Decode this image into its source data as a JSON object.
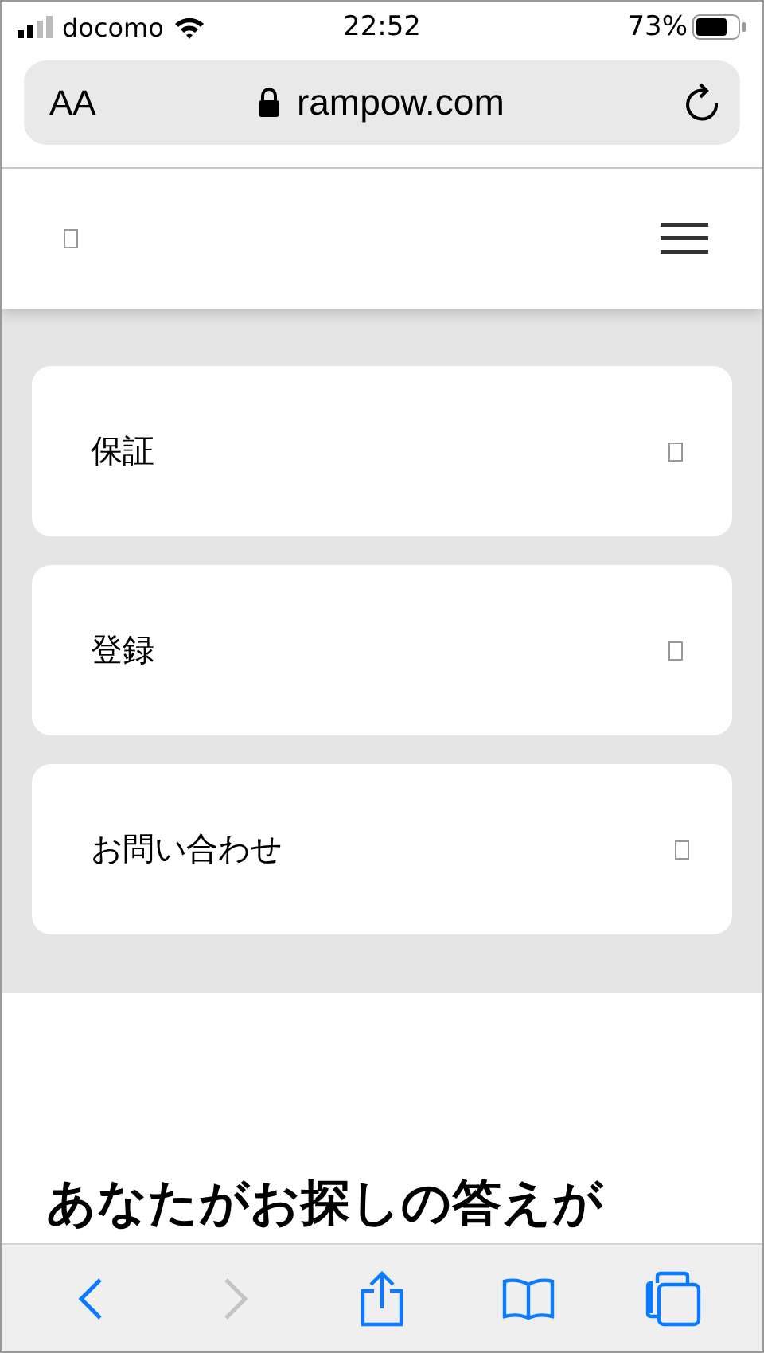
{
  "status_bar": {
    "carrier": "docomo",
    "time": "22:52",
    "battery": "73%"
  },
  "address_bar": {
    "text_size_label": "AA",
    "url": "rampow.com"
  },
  "menu_items": [
    {
      "label": "保証"
    },
    {
      "label": "登録"
    },
    {
      "label": "お問い合わせ"
    }
  ],
  "heading": "あなたがお探しの答えが",
  "toolbar": [
    {
      "kind": "back",
      "disabled": false
    },
    {
      "kind": "forward",
      "disabled": true
    },
    {
      "kind": "share",
      "disabled": false
    },
    {
      "kind": "bookmarks",
      "disabled": false
    },
    {
      "kind": "tabs",
      "disabled": false
    }
  ]
}
